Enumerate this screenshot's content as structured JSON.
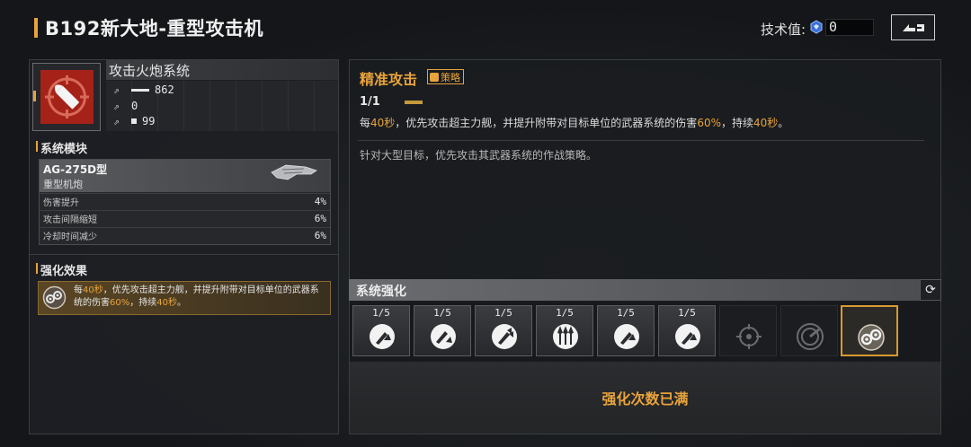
{
  "header": {
    "title": "B192新大地-重型攻击机",
    "tech_label": "技术值:",
    "tech_value": "0"
  },
  "weapon": {
    "name": "攻击火炮系统",
    "stats": [
      {
        "icon": "attack-icon",
        "value": "862"
      },
      {
        "icon": "interval-icon",
        "value": "0"
      },
      {
        "icon": "range-icon",
        "value": "99"
      }
    ]
  },
  "modules": {
    "section_title": "系统模块",
    "card": {
      "name": "AG-275D型",
      "type": "重型机炮",
      "rows": [
        {
          "label": "伤害提升",
          "value": "4%"
        },
        {
          "label": "攻击间隔缩短",
          "value": "6%"
        },
        {
          "label": "冷却时间减少",
          "value": "6%"
        }
      ]
    }
  },
  "enhance_effect": {
    "section_title": "强化效果",
    "text_parts": [
      "每",
      "40秒",
      "，优先攻击超主力舰，并提升附带对目标单位的武器系统的伤害",
      "60%",
      "，持续",
      "40秒",
      "。"
    ]
  },
  "skill": {
    "title": "精准攻击",
    "badge": "策略",
    "level": "1/1",
    "desc_parts": [
      "每",
      "40秒",
      "，优先攻击超主力舰，并提升附带对目标单位的武器系统的伤害",
      "60%",
      "，持续",
      "40秒",
      "。"
    ],
    "flavor": "针对大型目标，优先攻击其武器系统的作战策略。"
  },
  "system_enhance": {
    "title": "系统强化",
    "slots": [
      {
        "count": "1/5",
        "icon": "weapon-up-icon",
        "state": "active"
      },
      {
        "count": "1/5",
        "icon": "weapon-boost-icon",
        "state": "active"
      },
      {
        "count": "1/5",
        "icon": "weapon-double-icon",
        "state": "active"
      },
      {
        "count": "1/5",
        "icon": "triple-arrow-icon",
        "state": "active"
      },
      {
        "count": "1/5",
        "icon": "weapon-up-icon",
        "state": "active"
      },
      {
        "count": "1/5",
        "icon": "weapon-up-icon",
        "state": "active"
      },
      {
        "count": "",
        "icon": "target-lock-icon",
        "state": "locked"
      },
      {
        "count": "",
        "icon": "radar-icon",
        "state": "locked"
      },
      {
        "count": "",
        "icon": "strategy-icon",
        "state": "selected"
      }
    ],
    "maxed_text": "强化次数已满"
  },
  "colors": {
    "accent": "#e8a33c",
    "weapon_icon_bg": "#a52219"
  }
}
